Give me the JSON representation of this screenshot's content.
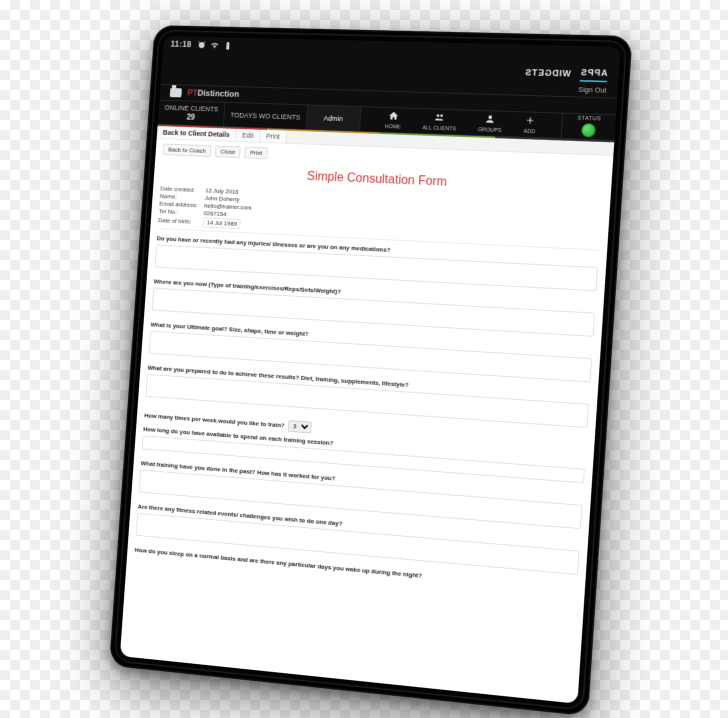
{
  "status_bar": {
    "time": "11:18"
  },
  "launcher": {
    "apps": "APPS",
    "widgets": "WIDGETS"
  },
  "header": {
    "sign_out": "Sign Out",
    "brand_prefix": "PT",
    "brand_rest": "Distinction"
  },
  "nav": {
    "clients_tile_label": "ONLINE CLIENTS",
    "clients_value": "29",
    "today_tile_label": "TODAYS WO CLIENTS",
    "admin_tile_label": "Admin",
    "home_label": "HOME",
    "clients_label": "ALL CLIENTS",
    "groups_label": "GROUPS",
    "add_label": "ADD",
    "status_label": "STATUS"
  },
  "crumbs": {
    "a": "Back to Client Details",
    "b": "Edit",
    "c": "Print"
  },
  "actions": {
    "back": "Back to Coach",
    "close": "Close",
    "print": "Print"
  },
  "form": {
    "title": "Simple Consultation Form",
    "date_created_label": "Date created:",
    "date_created_value": "12 July 2016",
    "name_label": "Name:",
    "name_value": "John Doherty",
    "email_label": "Email address:",
    "email_value": "hello@trainer.com",
    "tel_label": "Tel No.:",
    "tel_value": "0267154",
    "dob_label": "Date of birth:",
    "dob_value": "14 Jul 1989",
    "q1": "Do you have or recently had any injuries/ illnesses or are you on any medications?",
    "q2": "Where are you now (Type of training/exercises/Reps/Sets/Weight)?",
    "q3": "What is your Ultimate goal? Size, shape, time or weight?",
    "q4": "What are you prepared to do to achieve these results? Diet, training, supplements, lifestyle?",
    "q5": "How many times per week would you like to train?",
    "q5_default": "3",
    "q6": "How long do you have available to spend on each training session?",
    "q7": "What training have you done in the past? How has it worked for you?",
    "q8": "Are there any fitness related events/ challenges you wish to do one day?",
    "q9": "How do you sleep on a normal basis and are there any particular days you wake up during the night?"
  }
}
